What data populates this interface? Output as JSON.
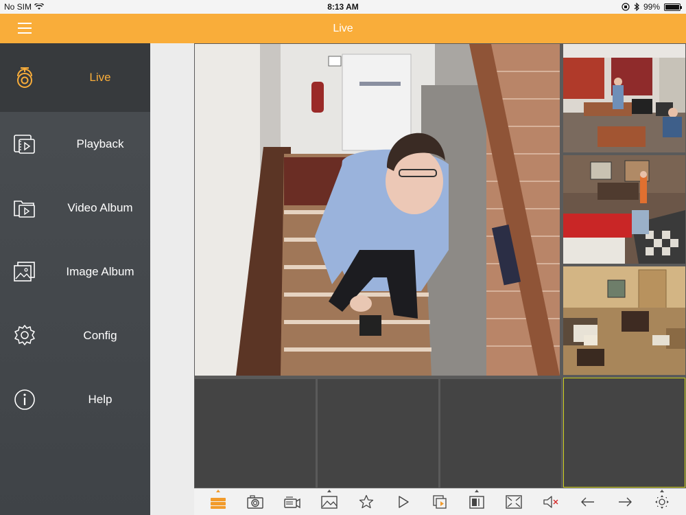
{
  "status_bar": {
    "carrier": "No SIM",
    "time": "8:13 AM",
    "battery": "99%",
    "battery_level": 0.99
  },
  "header": {
    "title": "Live",
    "menu_icon": "hamburger-icon"
  },
  "colors": {
    "accent": "#f9ad3a",
    "sidebar": "#45494d",
    "sidebar_active": "#373a3d",
    "selected_cell_border": "#cfd11a"
  },
  "sidebar": {
    "items": [
      {
        "label": "Live",
        "icon": "camera-icon",
        "active": true
      },
      {
        "label": "Playback",
        "icon": "playback-icon",
        "active": false
      },
      {
        "label": "Video Album",
        "icon": "video-album-icon",
        "active": false
      },
      {
        "label": "Image Album",
        "icon": "image-album-icon",
        "active": false
      },
      {
        "label": "Config",
        "icon": "gear-icon",
        "active": false
      },
      {
        "label": "Help",
        "icon": "info-icon",
        "active": false
      }
    ]
  },
  "live_view": {
    "channels": [
      {
        "name": "camera-feed-stairway",
        "content": "main"
      },
      {
        "name": "camera-feed-office",
        "content": "small"
      },
      {
        "name": "camera-feed-lobby",
        "content": "small"
      },
      {
        "name": "camera-feed-lounge",
        "content": "small"
      },
      {
        "name": "camera-feed-empty",
        "content": "empty"
      },
      {
        "name": "camera-feed-empty",
        "content": "empty"
      },
      {
        "name": "camera-feed-empty",
        "content": "empty"
      },
      {
        "name": "camera-feed-empty",
        "content": "empty"
      }
    ]
  },
  "toolbar": {
    "buttons": [
      "stream-select-icon",
      "snapshot-icon",
      "record-icon",
      "image-quality-icon",
      "favorite-icon",
      "play-icon",
      "playback-toggle-icon",
      "split-layout-icon",
      "fullscreen-icon",
      "mute-icon",
      "previous-icon",
      "next-icon",
      "ptz-icon"
    ]
  }
}
